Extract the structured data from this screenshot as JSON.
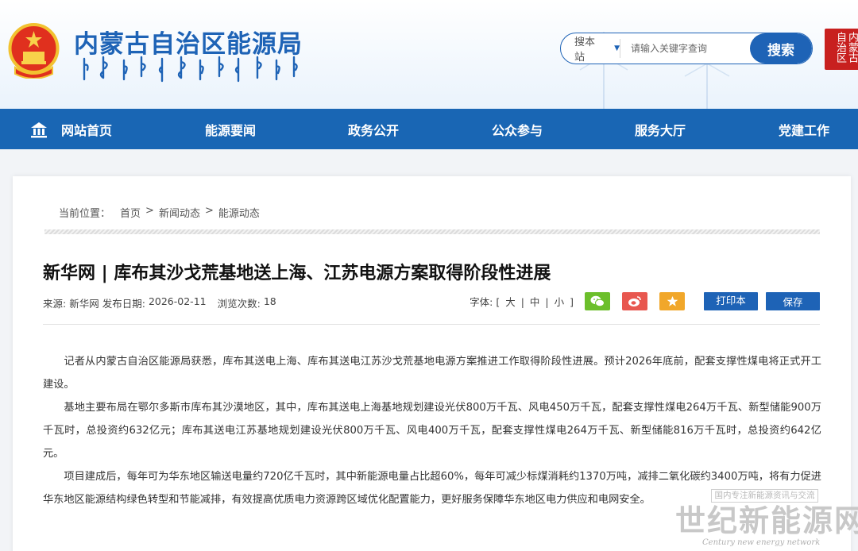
{
  "header": {
    "site_title": "内蒙古自治区能源局",
    "side_seal_text": "内蒙古自治区",
    "search": {
      "scope_label": "搜本站",
      "placeholder": "请输入关键字查询",
      "button_label": "搜索"
    }
  },
  "nav": {
    "items": [
      {
        "label": "网站首页",
        "icon": "home-icon"
      },
      {
        "label": "能源要闻"
      },
      {
        "label": "政务公开"
      },
      {
        "label": "公众参与"
      },
      {
        "label": "服务大厅"
      },
      {
        "label": "党建工作"
      }
    ]
  },
  "breadcrumb": {
    "prefix": "当前位置：",
    "items": [
      "首页",
      ">",
      "新闻动态",
      ">",
      "能源动态"
    ]
  },
  "article": {
    "title": "新华网 | 库布其沙戈荒基地送上海、江苏电源方案取得阶段性进展",
    "meta": {
      "source_label": "来源:",
      "source": "新华网",
      "date_label": "发布日期:",
      "date": "2026-02-11",
      "views_label": "浏览次数:",
      "views": "18"
    },
    "tools": {
      "font_label": "字体:",
      "bracket_open": "[",
      "size_large": "大",
      "sep1": "|",
      "size_medium": "中",
      "sep2": "|",
      "size_small": "小",
      "bracket_close": "]",
      "print_label": "打印本页",
      "save_label": "保存"
    },
    "paragraphs": [
      "记者从内蒙古自治区能源局获悉，库布其送电上海、库布其送电江苏沙戈荒基地电源方案推进工作取得阶段性进展。预计2026年底前，配套支撑性煤电将正式开工建设。",
      "基地主要布局在鄂尔多斯市库布其沙漠地区，其中，库布其送电上海基地规划建设光伏800万千瓦、风电450万千瓦，配套支撑性煤电264万千瓦、新型储能900万千瓦时，总投资约632亿元；库布其送电江苏基地规划建设光伏800万千瓦、风电400万千瓦，配套支撑性煤电264万千瓦、新型储能816万千瓦时，总投资约642亿元。",
      "项目建成后，每年可为华东地区输送电量约720亿千瓦时，其中新能源电量占比超60%，每年可减少标煤消耗约1370万吨，减排二氧化碳约3400万吨，将有力促进华东地区能源结构绿色转型和节能减排，有效提高优质电力资源跨区域优化配置能力，更好服务保障华东地区电力供应和电网安全。"
    ]
  },
  "watermark": {
    "caption": "国内专注新能源资讯与交流",
    "title": "世纪新能源网",
    "subtitle": "Century new energy network"
  },
  "colors": {
    "brand_blue": "#1966b4",
    "wechat_green": "#6cbf2b",
    "weibo_red": "#e8574f",
    "fav_orange": "#f1a72a"
  }
}
